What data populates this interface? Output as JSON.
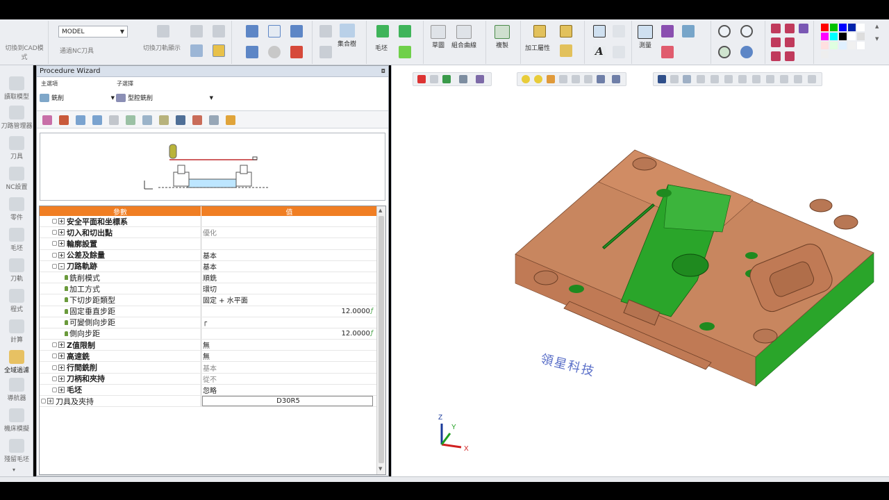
{
  "ribbon": {
    "items": {
      "switch_cad": "切換到CAD模\n式",
      "universal_nc": "通過NC刀具",
      "switch_tool_display": "切換刀軌顯示",
      "assembly_tree": "集合樹",
      "stock": "毛坯",
      "sketch": "草圖",
      "combined_curve": "組合曲線",
      "copy": "複製",
      "machining_attr": "加工屬性",
      "measure": "測量"
    },
    "model_select": "MODEL",
    "palette": [
      "#ff0000",
      "#00c000",
      "#0000ff",
      "#0022aa",
      "#ffffff",
      "#ff00ff",
      "#00ffff",
      "#000000",
      "#ffffff",
      "#dddddd",
      "#ffe0e0",
      "#e0ffe0",
      "#e0f0ff",
      "#f0f0f0",
      "#ffffff",
      "#eeeeee"
    ]
  },
  "leftbar": {
    "items": [
      "讀取模型",
      "刀路管理器",
      "刀具",
      "NC設置",
      "零件",
      "毛坯",
      "刀軌",
      "程式",
      "計算",
      "全域過濾",
      "導航器",
      "機床模擬",
      "殘留毛坯"
    ]
  },
  "wizard": {
    "title": "Procedure Wizard",
    "main_label": "主選項",
    "sub_label": "子選擇",
    "main_value": "銑削",
    "sub_value": "型腔銑削",
    "grid": {
      "header_param": "參數",
      "header_value": "值",
      "rows": [
        {
          "key": "安全平面和坐標系",
          "val": "",
          "level": 1,
          "exp": "+",
          "bold": true
        },
        {
          "key": "切入和切出點",
          "val": "優化",
          "level": 1,
          "exp": "+",
          "bold": true,
          "dim": true
        },
        {
          "key": "輪廓設置",
          "val": "",
          "level": 1,
          "exp": "+",
          "bold": true
        },
        {
          "key": "公差及餘量",
          "val": "基本",
          "level": 1,
          "exp": "+",
          "bold": true
        },
        {
          "key": "刀路軌跡",
          "val": "基本",
          "level": 1,
          "exp": "-",
          "bold": true
        },
        {
          "key": "銑削模式",
          "val": "順銑",
          "level": 2
        },
        {
          "key": "加工方式",
          "val": "環切",
          "level": 2
        },
        {
          "key": "下切步距類型",
          "val": "固定 + 水平面",
          "level": 2
        },
        {
          "key": "固定垂直步距",
          "val": "12.0000",
          "level": 2,
          "right": true,
          "fx": true
        },
        {
          "key": "可變側向步距",
          "val": "┌",
          "level": 2
        },
        {
          "key": "側向步距",
          "val": "12.0000",
          "level": 2,
          "right": true,
          "fx": true
        },
        {
          "key": "Z值限制",
          "val": "無",
          "level": 1,
          "exp": "+",
          "bold": true
        },
        {
          "key": "高速銑",
          "val": "無",
          "level": 1,
          "exp": "+",
          "bold": true
        },
        {
          "key": "行間銑削",
          "val": "基本",
          "level": 1,
          "exp": "+",
          "bold": true,
          "dim": true
        },
        {
          "key": "刀柄和夾持",
          "val": "從不",
          "level": 1,
          "exp": "+",
          "bold": true,
          "dim": true
        },
        {
          "key": "毛坯",
          "val": "忽略",
          "level": 1,
          "exp": "+",
          "bold": true
        },
        {
          "key": "刀具及夾持",
          "val": "D30R5",
          "level": 0,
          "exp": "+",
          "bold": false,
          "boxed": true
        }
      ]
    }
  },
  "viewport": {
    "watermark": "領星科技",
    "axes": {
      "z": "Z",
      "y": "Y",
      "x": "X"
    }
  },
  "colors": {
    "part_body": "#c8865f",
    "part_dark": "#a86a48",
    "selection": "#2aa52a",
    "accent": "#f07e23"
  }
}
